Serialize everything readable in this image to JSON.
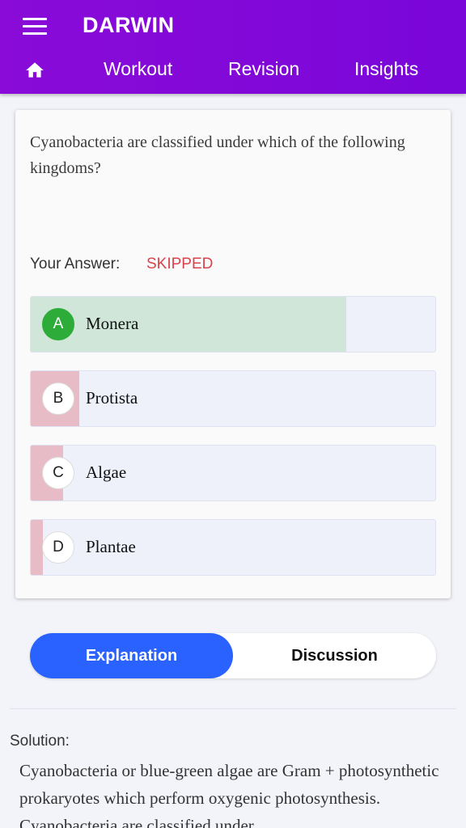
{
  "header": {
    "title": "DARWIN",
    "nav": {
      "workout": "Workout",
      "revision": "Revision",
      "insights": "Insights"
    }
  },
  "question": {
    "text": "Cyanobacteria are classified under which of the following kingdoms?",
    "your_answer_label": "Your Answer:",
    "your_answer_value": "SKIPPED"
  },
  "options": [
    {
      "letter": "A",
      "text": "Monera",
      "correct": true,
      "share": 0.78
    },
    {
      "letter": "B",
      "text": "Protista",
      "correct": false,
      "share": 0.12
    },
    {
      "letter": "C",
      "text": "Algae",
      "correct": false,
      "share": 0.08
    },
    {
      "letter": "D",
      "text": "Plantae",
      "correct": false,
      "share": 0.03
    }
  ],
  "colors": {
    "correct_fill": "#cfe6d8",
    "wrong_fill": "#e8bcc6",
    "accent": "#2962ff",
    "header": "#7f08d9"
  },
  "tabs": {
    "explanation": "Explanation",
    "discussion": "Discussion"
  },
  "solution": {
    "label": "Solution:",
    "text": "Cyanobacteria or blue-green algae are Gram + photosynthetic prokaryotes which perform oxygenic photosynthesis. Cyanobacteria are classified under"
  }
}
